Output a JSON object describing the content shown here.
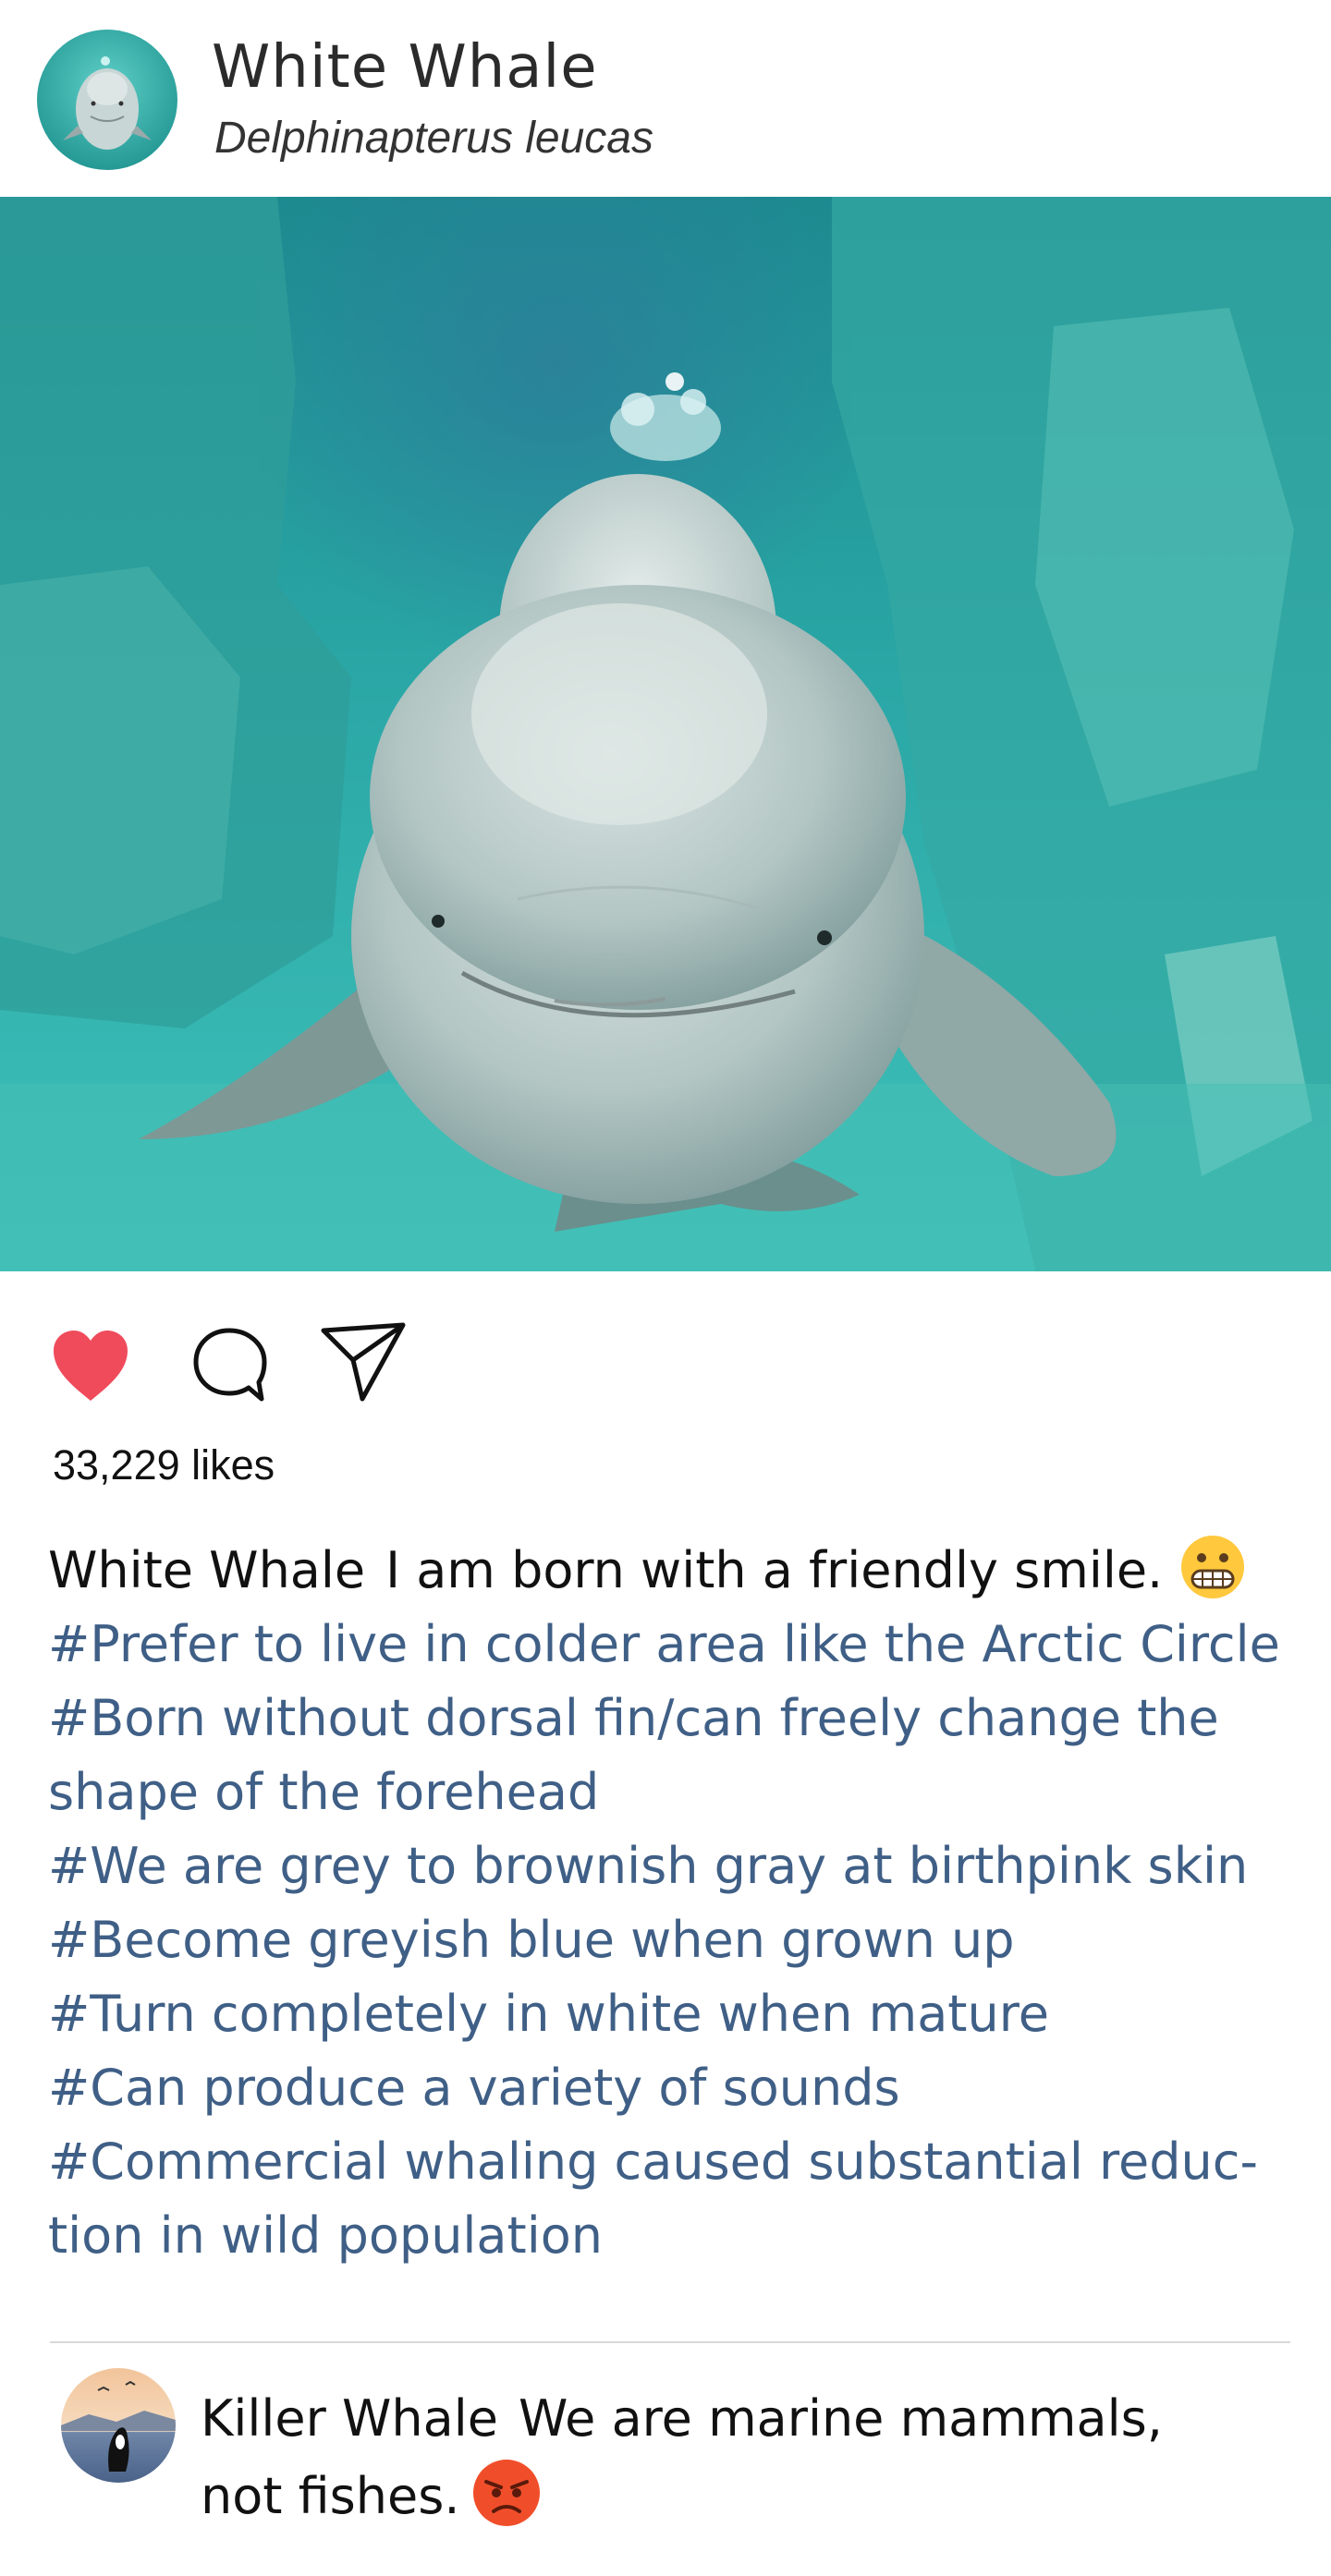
{
  "post": {
    "author_name": "White Whale",
    "author_subtitle": "Delphinapterus leucas",
    "likes_text": "33,229 likes",
    "liked": true,
    "caption_user": "White Whale",
    "caption_text": "I am born with a friendly smile.",
    "caption_emoji": "grimacing-face-emoji",
    "hashtags": [
      "#Prefer to live in colder area like the Arctic Circle",
      "#Born without dorsal fin/can freely change the",
      "shape of the forehead",
      "#We are grey to brownish gray at birthpink skin",
      "#Become greyish blue when grown up",
      "#Turn completely in white when mature",
      "#Can produce a variety of sounds",
      "#Commercial whaling caused substantial reduc-",
      "tion in wild population"
    ]
  },
  "comment": {
    "user": "Killer Whale",
    "text_line1": "We are marine mammals,",
    "text_line2": "not fishes.",
    "emoji": "angry-face-emoji"
  },
  "colors": {
    "heart": "#ef4b5b",
    "hashtag": "#3f5f86",
    "water": "#2ab3b0",
    "divider": "#d9d9d9"
  },
  "icons": [
    "heart-icon",
    "comment-icon",
    "send-icon"
  ]
}
